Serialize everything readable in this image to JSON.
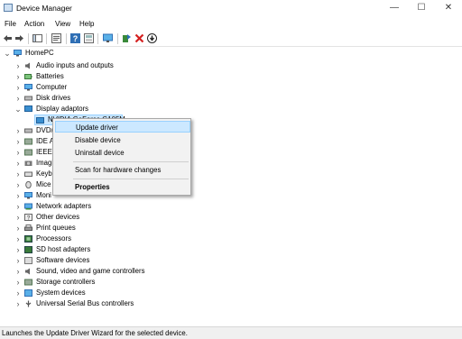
{
  "window": {
    "title": "Device Manager",
    "minimize": "—",
    "maximize": "☐",
    "close": "✕"
  },
  "menu": [
    "File",
    "Action",
    "View",
    "Help"
  ],
  "toolbar": {
    "icons": [
      "back-arrow-icon",
      "forward-arrow-icon",
      "show-hide-console-tree-icon",
      "properties-icon",
      "help-icon",
      "view-icon",
      "monitor-icon",
      "update-driver-icon",
      "uninstall-red-x-icon",
      "download-driver-icon"
    ]
  },
  "tree": {
    "root": "HomePC",
    "categories": [
      {
        "label": "Audio inputs and outputs",
        "icon": "speaker-icon",
        "expanded": false
      },
      {
        "label": "Batteries",
        "icon": "battery-icon",
        "expanded": false
      },
      {
        "label": "Computer",
        "icon": "computer-icon",
        "expanded": false
      },
      {
        "label": "Disk drives",
        "icon": "disk-drive-icon",
        "expanded": false
      },
      {
        "label": "Display adaptors",
        "icon": "display-adapter-icon",
        "expanded": true,
        "children": [
          {
            "label": "NVIDIA GeForce G105M",
            "icon": "display-adapter-icon",
            "selected": true
          }
        ]
      },
      {
        "label": "DVD/",
        "icon": "dvd-drive-icon",
        "expanded": false
      },
      {
        "label": "IDE A",
        "icon": "ide-controller-icon",
        "expanded": false
      },
      {
        "label": "IEEE 1",
        "icon": "ieee-1394-icon",
        "expanded": false
      },
      {
        "label": "Imagi",
        "icon": "imaging-device-icon",
        "expanded": false
      },
      {
        "label": "Keyb",
        "icon": "keyboard-icon",
        "expanded": false
      },
      {
        "label": "Mice",
        "icon": "mouse-icon",
        "expanded": false
      },
      {
        "label": "Moni",
        "icon": "monitor-icon",
        "expanded": false
      },
      {
        "label": "Network adapters",
        "icon": "network-adapter-icon",
        "expanded": false
      },
      {
        "label": "Other devices",
        "icon": "other-devices-icon",
        "expanded": false
      },
      {
        "label": "Print queues",
        "icon": "printer-icon",
        "expanded": false
      },
      {
        "label": "Processors",
        "icon": "processor-icon",
        "expanded": false
      },
      {
        "label": "SD host adapters",
        "icon": "sd-card-icon",
        "expanded": false
      },
      {
        "label": "Software devices",
        "icon": "software-device-icon",
        "expanded": false
      },
      {
        "label": "Sound, video and game controllers",
        "icon": "speaker-icon",
        "expanded": false
      },
      {
        "label": "Storage controllers",
        "icon": "storage-controller-icon",
        "expanded": false
      },
      {
        "label": "System devices",
        "icon": "system-devices-icon",
        "expanded": false
      },
      {
        "label": "Universal Serial Bus controllers",
        "icon": "usb-icon",
        "expanded": false
      }
    ]
  },
  "context_menu": {
    "items": [
      {
        "label": "Update driver",
        "highlighted": true
      },
      {
        "label": "Disable device"
      },
      {
        "label": "Uninstall device"
      },
      {
        "separator": true
      },
      {
        "label": "Scan for hardware changes"
      },
      {
        "separator": true
      },
      {
        "label": "Properties",
        "bold": true
      }
    ]
  },
  "status": {
    "text": "Launches the Update Driver Wizard for the selected device."
  },
  "colors": {
    "selection": "#cce8ff",
    "selection_border": "#99d1ff",
    "menu_bg": "#f2f2f2",
    "accent_blue": "#2f6fb5",
    "red": "#d42020"
  }
}
